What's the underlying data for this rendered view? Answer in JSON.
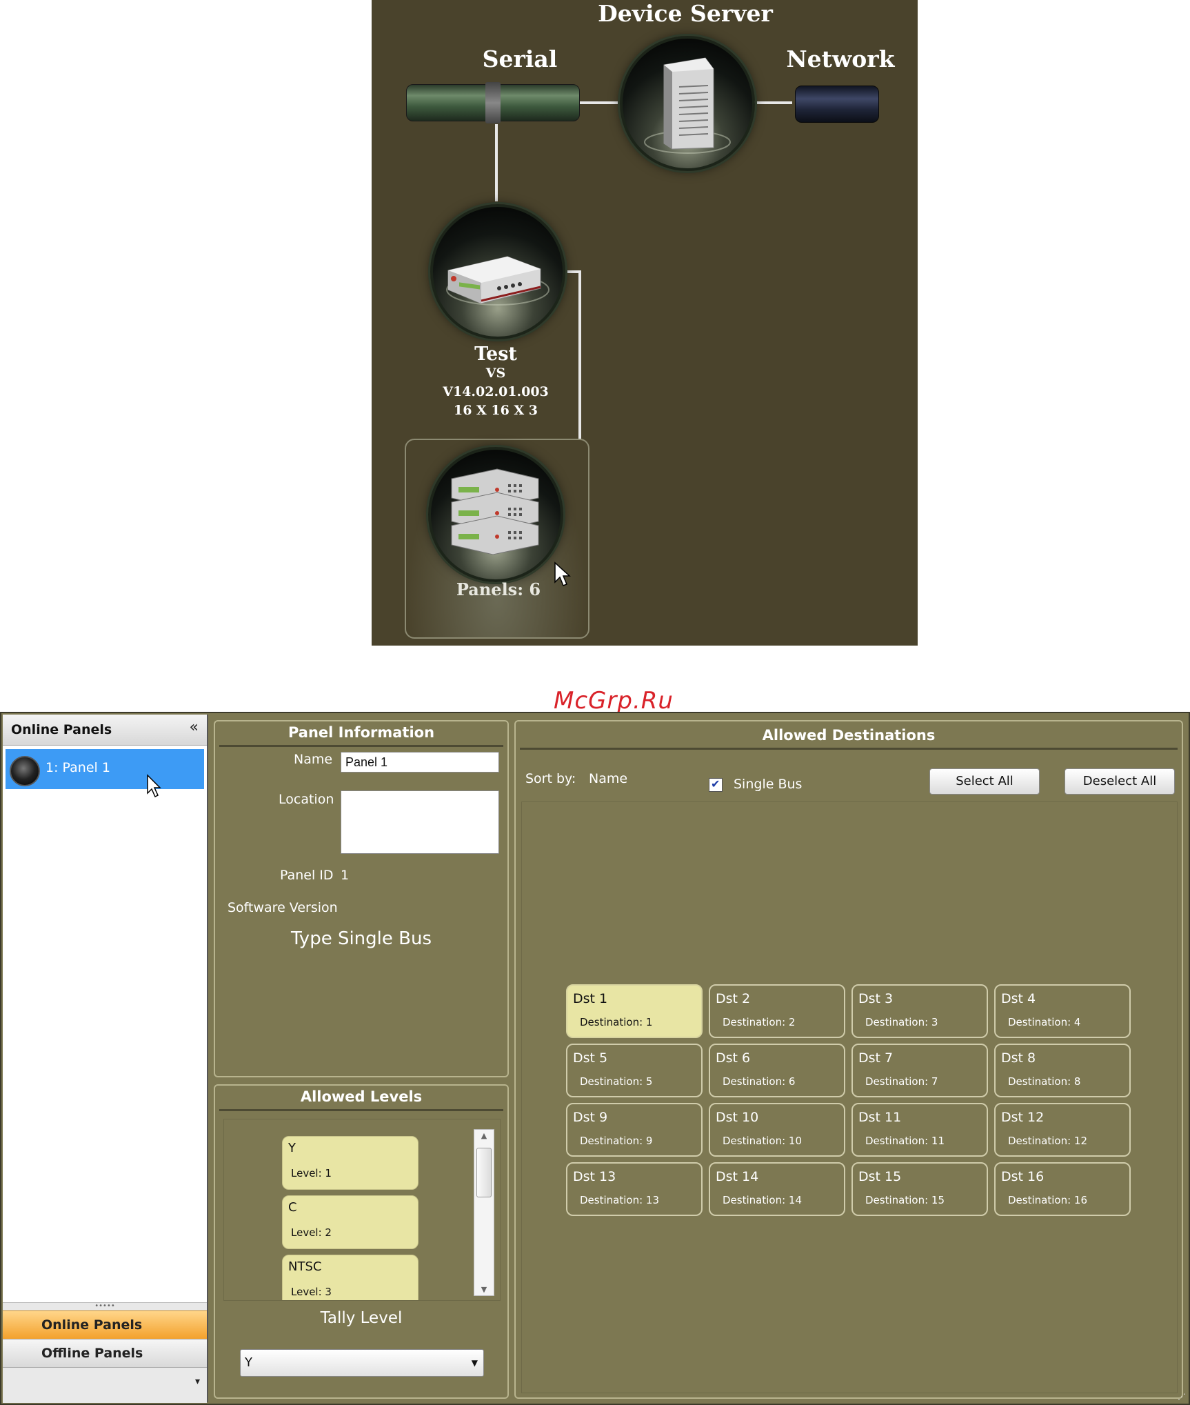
{
  "diagram": {
    "device_server_label": "Device Server",
    "serial_label": "Serial",
    "network_label": "Network",
    "router": {
      "name": "Test",
      "type": "VS",
      "version": "V14.02.01.003",
      "size": "16 X 16 X 3"
    },
    "panels_label": "Panels: 6"
  },
  "watermark": "McGrp.Ru",
  "sidebar": {
    "title": "Online Panels",
    "collapse_glyph": "«",
    "items": [
      {
        "label": "1: Panel 1"
      }
    ],
    "grip": "•••••",
    "online_tab": "Online Panels",
    "offline_tab": "Offline Panels",
    "dropdown_glyph": "▾"
  },
  "panel_info": {
    "title": "Panel Information",
    "name_label": "Name",
    "name_value": "Panel 1",
    "location_label": "Location",
    "location_value": "",
    "panel_id_label": "Panel ID",
    "panel_id_value": "1",
    "software_version_label": "Software Version",
    "type_text": "Type Single Bus"
  },
  "allowed_levels": {
    "title": "Allowed Levels",
    "levels": [
      {
        "name": "Y",
        "level": "Level:  1"
      },
      {
        "name": "C",
        "level": "Level:  2"
      },
      {
        "name": "NTSC",
        "level": "Level:  3"
      }
    ],
    "tally_label": "Tally Level",
    "tally_value": "Y"
  },
  "allowed_destinations": {
    "title": "Allowed Destinations",
    "sort_label": "Sort by:",
    "sort_value": "Name",
    "single_bus_label": "Single Bus",
    "single_bus_checked": true,
    "select_all": "Select All",
    "deselect_all": "Deselect All",
    "destinations": [
      {
        "name": "Dst 1",
        "dest": "Destination:  1",
        "selected": true
      },
      {
        "name": "Dst 2",
        "dest": "Destination:  2"
      },
      {
        "name": "Dst 3",
        "dest": "Destination:  3"
      },
      {
        "name": "Dst 4",
        "dest": "Destination:  4"
      },
      {
        "name": "Dst 5",
        "dest": "Destination:  5"
      },
      {
        "name": "Dst 6",
        "dest": "Destination:  6"
      },
      {
        "name": "Dst 7",
        "dest": "Destination:  7"
      },
      {
        "name": "Dst 8",
        "dest": "Destination:  8"
      },
      {
        "name": "Dst 9",
        "dest": "Destination:  9"
      },
      {
        "name": "Dst 10",
        "dest": "Destination:  10"
      },
      {
        "name": "Dst 11",
        "dest": "Destination:  11"
      },
      {
        "name": "Dst 12",
        "dest": "Destination:  12"
      },
      {
        "name": "Dst 13",
        "dest": "Destination:  13"
      },
      {
        "name": "Dst 14",
        "dest": "Destination:  14"
      },
      {
        "name": "Dst 15",
        "dest": "Destination:  15"
      },
      {
        "name": "Dst 16",
        "dest": "Destination:  16"
      }
    ]
  },
  "colors": {
    "panel_bg": "#7d7852",
    "diagram_bg": "#4a432c",
    "selection": "#3d9bf5",
    "card_selected": "#e8e5a4",
    "active_tab": "#f3a12c"
  }
}
